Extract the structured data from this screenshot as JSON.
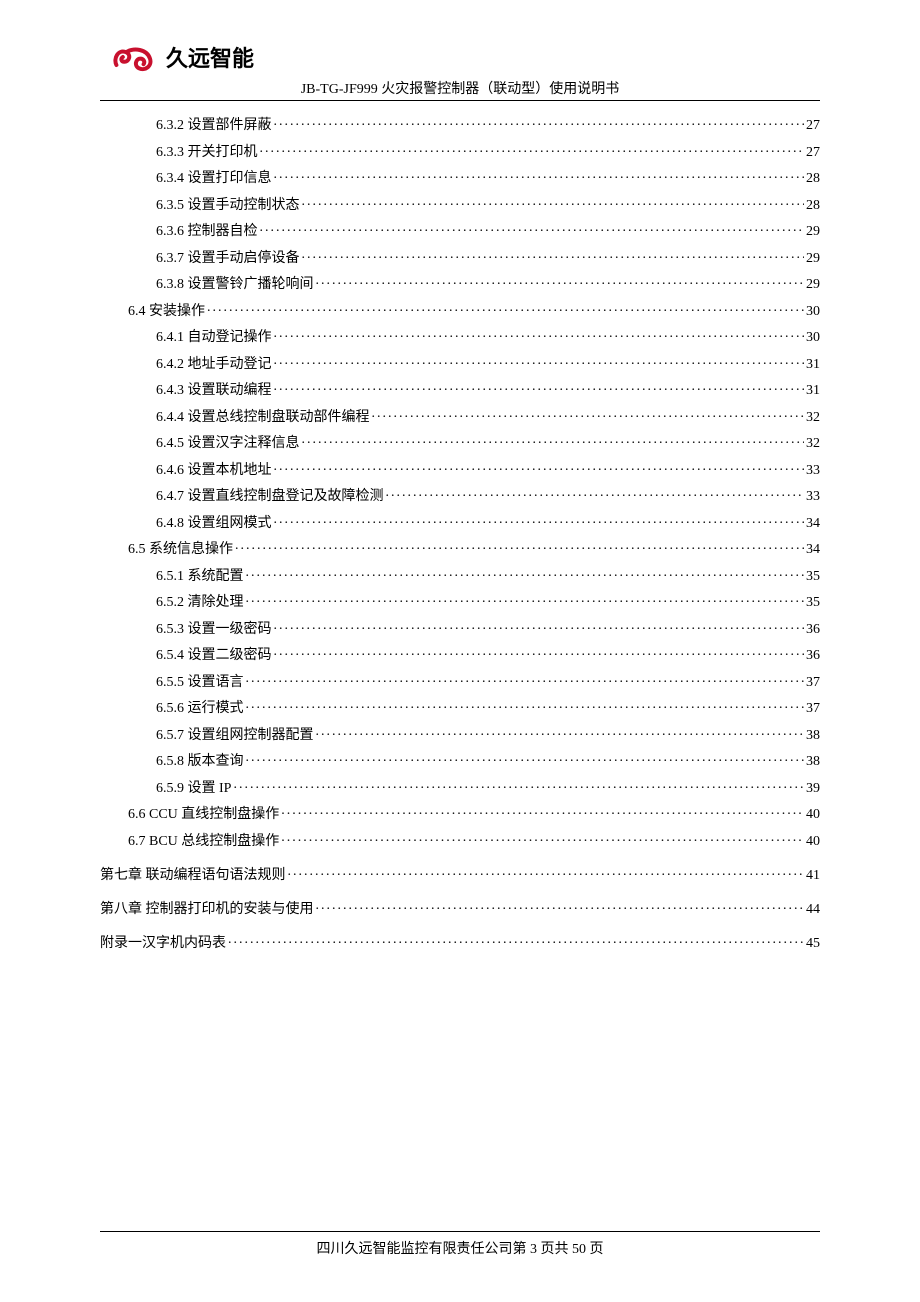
{
  "header": {
    "brand": "久远智能",
    "doc_title": "JB-TG-JF999 火灾报警控制器（联动型）使用说明书"
  },
  "toc": [
    {
      "indent": 2,
      "label": "6.3.2  设置部件屏蔽",
      "page": "27",
      "chapter": false
    },
    {
      "indent": 2,
      "label": "6.3.3  开关打印机",
      "page": "27",
      "chapter": false
    },
    {
      "indent": 2,
      "label": "6.3.4  设置打印信息",
      "page": "28",
      "chapter": false
    },
    {
      "indent": 2,
      "label": "6.3.5  设置手动控制状态",
      "page": "28",
      "chapter": false
    },
    {
      "indent": 2,
      "label": "6.3.6  控制器自检",
      "page": "29",
      "chapter": false
    },
    {
      "indent": 2,
      "label": "6.3.7  设置手动启停设备",
      "page": "29",
      "chapter": false
    },
    {
      "indent": 2,
      "label": "6.3.8 设置警铃广播轮响间",
      "page": "29",
      "chapter": false
    },
    {
      "indent": 1,
      "label": "6.4  安装操作",
      "page": "30",
      "chapter": false
    },
    {
      "indent": 2,
      "label": "6.4.1  自动登记操作",
      "page": "30",
      "chapter": false
    },
    {
      "indent": 2,
      "label": "6.4.2  地址手动登记",
      "page": "31",
      "chapter": false
    },
    {
      "indent": 2,
      "label": "6.4.3  设置联动编程",
      "page": "31",
      "chapter": false
    },
    {
      "indent": 2,
      "label": "6.4.4  设置总线控制盘联动部件编程",
      "page": "32",
      "chapter": false
    },
    {
      "indent": 2,
      "label": "6.4.5  设置汉字注释信息",
      "page": "32",
      "chapter": false
    },
    {
      "indent": 2,
      "label": "6.4.6  设置本机地址",
      "page": "33",
      "chapter": false
    },
    {
      "indent": 2,
      "label": "6.4.7  设置直线控制盘登记及故障检测",
      "page": "33",
      "chapter": false
    },
    {
      "indent": 2,
      "label": "6.4.8  设置组网模式",
      "page": "34",
      "chapter": false
    },
    {
      "indent": 1,
      "label": "6.5  系统信息操作",
      "page": "34",
      "chapter": false
    },
    {
      "indent": 2,
      "label": "6.5.1  系统配置",
      "page": "35",
      "chapter": false
    },
    {
      "indent": 2,
      "label": "6.5.2  清除处理",
      "page": "35",
      "chapter": false
    },
    {
      "indent": 2,
      "label": "6.5.3  设置一级密码",
      "page": "36",
      "chapter": false
    },
    {
      "indent": 2,
      "label": "6.5.4  设置二级密码",
      "page": "36",
      "chapter": false
    },
    {
      "indent": 2,
      "label": "6.5.5  设置语言",
      "page": "37",
      "chapter": false
    },
    {
      "indent": 2,
      "label": "6.5.6  运行模式",
      "page": "37",
      "chapter": false
    },
    {
      "indent": 2,
      "label": "6.5.7  设置组网控制器配置",
      "page": "38",
      "chapter": false
    },
    {
      "indent": 2,
      "label": "6.5.8  版本查询",
      "page": "38",
      "chapter": false
    },
    {
      "indent": 2,
      "label": "6.5.9 设置 IP",
      "page": "39",
      "chapter": false
    },
    {
      "indent": 1,
      "label": "6.6   CCU 直线控制盘操作",
      "page": "40",
      "chapter": false
    },
    {
      "indent": 1,
      "label": "6.7   BCU 总线控制盘操作",
      "page": "40",
      "chapter": false
    },
    {
      "indent": 0,
      "label": "第七章      联动编程语句语法规则",
      "page": "41",
      "chapter": true
    },
    {
      "indent": 0,
      "label": "第八章      控制器打印机的安装与使用",
      "page": "44",
      "chapter": true
    },
    {
      "indent": 0,
      "label": "附录一汉字机内码表",
      "page": "45",
      "chapter": true
    }
  ],
  "footer": {
    "text": "四川久远智能监控有限责任公司第 3 页共 50 页"
  }
}
